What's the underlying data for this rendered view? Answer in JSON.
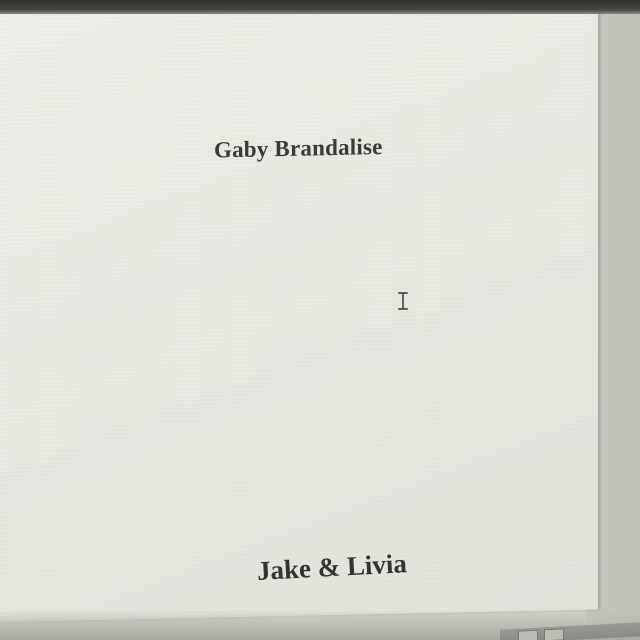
{
  "document": {
    "heading": "Gaby Brandalise",
    "footer_line": "Jake & Livia"
  },
  "icons": {
    "cursor": "text-cursor-icon"
  },
  "colors": {
    "page": "#e9e9e2",
    "text": "#3b3a36",
    "bezel": "#2f2e2b"
  }
}
